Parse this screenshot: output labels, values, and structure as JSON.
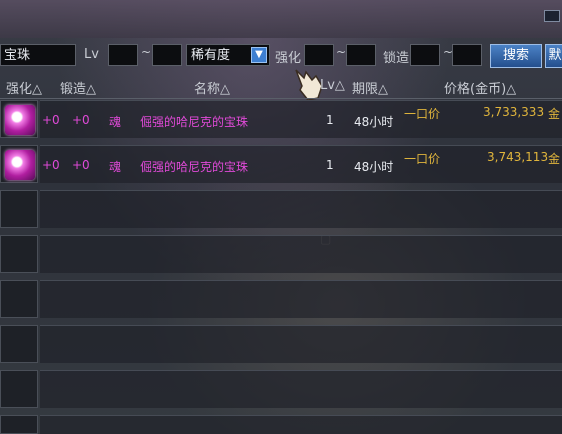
{
  "search": {
    "keyword_value": "宝珠",
    "lv_label": "Lv",
    "range_sep": "~",
    "rarity_value": "稀有度",
    "enhance_label": "强化",
    "lock_label": "锁造",
    "search_button": "搜索",
    "default_button": "默"
  },
  "columns": [
    "强化△",
    "锻造△",
    "名称△",
    "Lv△",
    "期限△",
    "价格(金币)△"
  ],
  "items": [
    {
      "enhance": "+0",
      "forge": "+0",
      "soul": "魂",
      "name": "倔强的哈尼克的宝珠",
      "lv": "1",
      "period": "48小时",
      "sale_type": "一口价",
      "price": "3,733,333",
      "currency": "金"
    },
    {
      "enhance": "+0",
      "forge": "+0",
      "soul": "魂",
      "name": "倔强的哈尼克的宝珠",
      "lv": "1",
      "period": "48小时",
      "sale_type": "一口价",
      "price": "3,743,113",
      "currency": "金"
    }
  ],
  "colors": {
    "accent": "#3d7fd1",
    "item_name": "#e04ad8",
    "sale_type": "#e0b53c",
    "header_text": "#c9cdd4"
  },
  "icons": {
    "item": "orb-icon",
    "cursor": "hand-cursor-icon",
    "dropdown": "chevron-down-icon"
  }
}
